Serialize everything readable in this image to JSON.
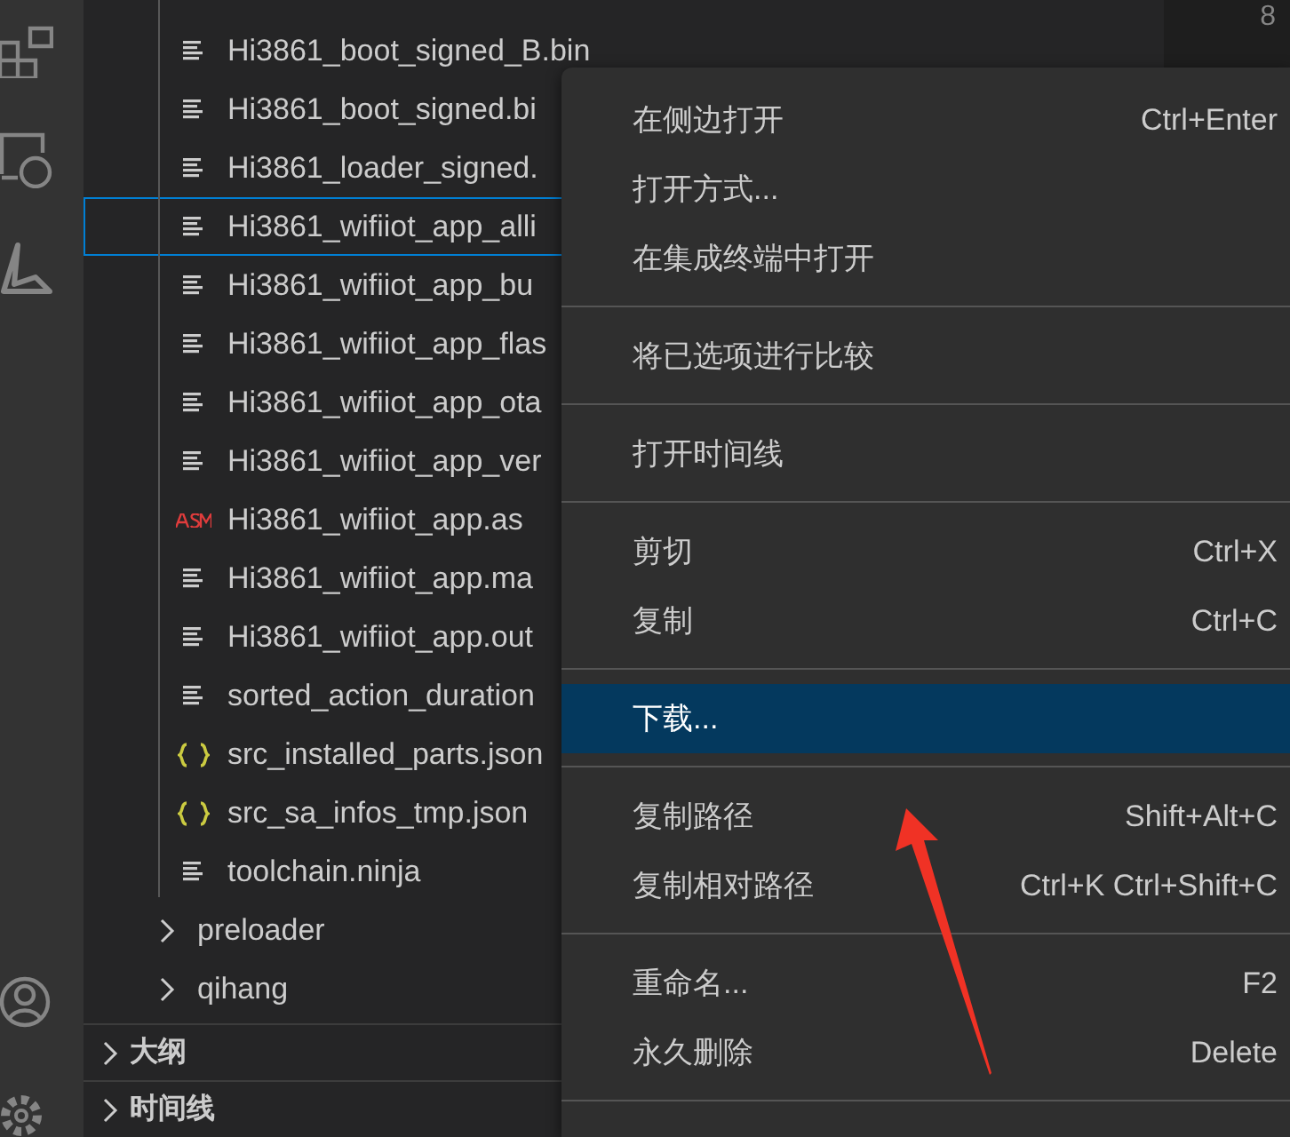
{
  "explorer": {
    "items": [
      {
        "kind": "file",
        "label": "Hi3861_boot_signed_B.bin",
        "selected": false
      },
      {
        "kind": "file",
        "label": "Hi3861_boot_signed.bi",
        "selected": false
      },
      {
        "kind": "file",
        "label": "Hi3861_loader_signed.",
        "selected": false
      },
      {
        "kind": "file",
        "label": "Hi3861_wifiiot_app_alli",
        "selected": true
      },
      {
        "kind": "file",
        "label": "Hi3861_wifiiot_app_bu",
        "selected": false
      },
      {
        "kind": "file",
        "label": "Hi3861_wifiiot_app_flas",
        "selected": false
      },
      {
        "kind": "file",
        "label": "Hi3861_wifiiot_app_ota",
        "selected": false
      },
      {
        "kind": "file",
        "label": "Hi3861_wifiiot_app_ver",
        "selected": false
      },
      {
        "kind": "asm",
        "label": "Hi3861_wifiiot_app.as",
        "selected": false
      },
      {
        "kind": "file",
        "label": "Hi3861_wifiiot_app.ma",
        "selected": false
      },
      {
        "kind": "file",
        "label": "Hi3861_wifiiot_app.out",
        "selected": false
      },
      {
        "kind": "file",
        "label": "sorted_action_duration",
        "selected": false
      },
      {
        "kind": "json",
        "label": "src_installed_parts.json",
        "selected": false
      },
      {
        "kind": "json",
        "label": "src_sa_infos_tmp.json",
        "selected": false
      },
      {
        "kind": "file",
        "label": "toolchain.ninja",
        "selected": false
      }
    ],
    "folders": [
      {
        "label": "preloader",
        "expanded": false
      },
      {
        "label": "qihang",
        "expanded": false
      }
    ]
  },
  "panels": [
    {
      "title": "大纲",
      "expanded": false
    },
    {
      "title": "时间线",
      "expanded": false
    }
  ],
  "editor": {
    "line_numbers": [
      "8"
    ]
  },
  "context_menu": {
    "groups": [
      [
        {
          "label": "在侧边打开",
          "shortcut": "Ctrl+Enter",
          "selected": false
        },
        {
          "label": "打开方式...",
          "selected": false
        },
        {
          "label": "在集成终端中打开",
          "selected": false
        }
      ],
      [
        {
          "label": "将已选项进行比较",
          "selected": false
        }
      ],
      [
        {
          "label": "打开时间线",
          "selected": false
        }
      ],
      [
        {
          "label": "剪切",
          "shortcut": "Ctrl+X",
          "selected": false
        },
        {
          "label": "复制",
          "shortcut": "Ctrl+C",
          "selected": false
        }
      ],
      [
        {
          "label": "下载...",
          "selected": true
        }
      ],
      [
        {
          "label": "复制路径",
          "shortcut": "Shift+Alt+C",
          "selected": false
        },
        {
          "label": "复制相对路径",
          "shortcut": "Ctrl+K Ctrl+Shift+C",
          "selected": false
        }
      ],
      [
        {
          "label": "重命名...",
          "shortcut": "F2",
          "selected": false
        },
        {
          "label": "永久删除",
          "shortcut": "Delete",
          "selected": false
        }
      ]
    ]
  }
}
